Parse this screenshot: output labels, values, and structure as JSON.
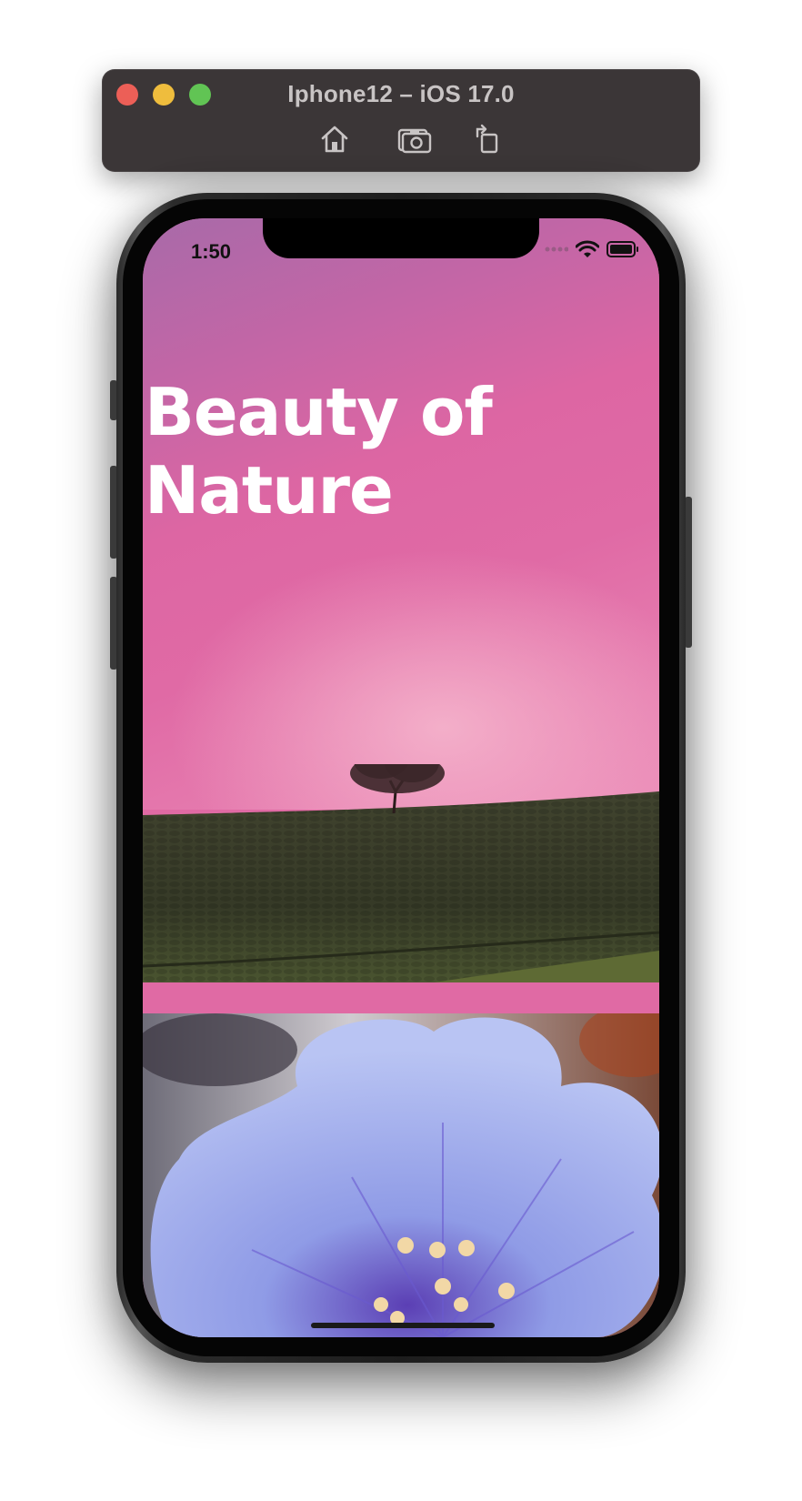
{
  "window": {
    "title": "Iphone12 – iOS 17.0",
    "toolbar_buttons": [
      {
        "name": "home",
        "icon": "home-icon"
      },
      {
        "name": "screenshot",
        "icon": "camera-icon"
      },
      {
        "name": "rotate",
        "icon": "rotate-icon"
      }
    ]
  },
  "status_bar": {
    "time": "1:50",
    "icons": [
      "signal-dots-icon",
      "wifi-icon",
      "battery-icon"
    ]
  },
  "screen": {
    "title_line1": "Beauty of",
    "title_line2": "Nature",
    "images": [
      "tree-on-hill",
      "purple-flower"
    ],
    "colors": {
      "sky_pink": "#e06aa4",
      "sky_purple": "#a86aa9",
      "hill_green": "#3a3e2a",
      "flower_blue": "#9aa8ec"
    }
  }
}
